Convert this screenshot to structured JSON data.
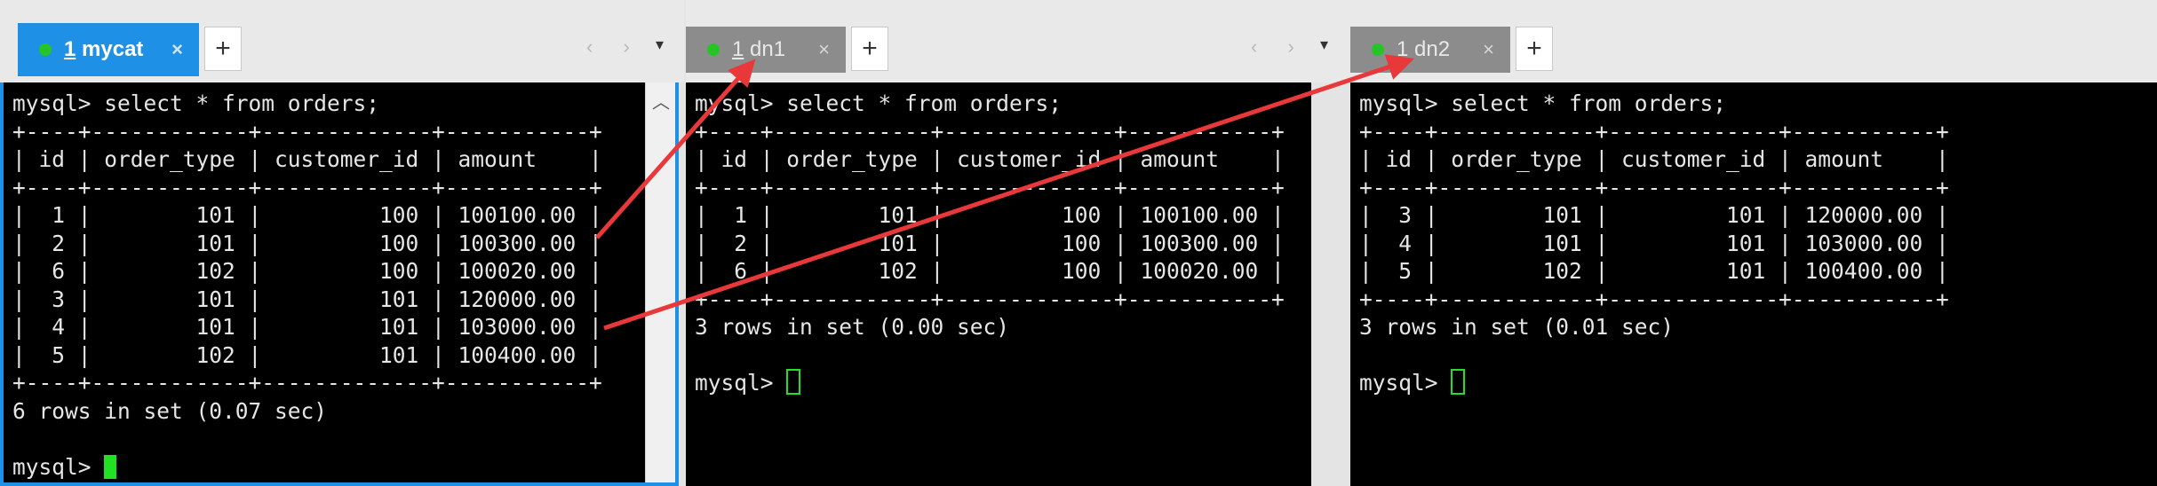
{
  "panes": [
    {
      "tab": {
        "number": "1",
        "name": "mycat",
        "close": "×"
      },
      "plus": "+",
      "nav": "‹ ›",
      "dropdown": "▾",
      "lines": [
        "mysql> select * from orders;",
        "+----+------------+-------------+-----------+",
        "| id | order_type | customer_id | amount    |",
        "+----+------------+-------------+-----------+",
        "|  1 |        101 |         100 | 100100.00 |",
        "|  2 |        101 |         100 | 100300.00 |",
        "|  6 |        102 |         100 | 100020.00 |",
        "|  3 |        101 |         101 | 120000.00 |",
        "|  4 |        101 |         101 | 103000.00 |",
        "|  5 |        102 |         101 | 100400.00 |",
        "+----+------------+-------------+-----------+",
        "6 rows in set (0.07 sec)",
        ""
      ],
      "prompt": "mysql> "
    },
    {
      "tab": {
        "number": "1",
        "name": "dn1",
        "close": "×"
      },
      "plus": "+",
      "nav": "‹ ›",
      "dropdown": "▾",
      "lines": [
        "mysql> select * from orders;",
        "+----+------------+-------------+-----------+",
        "| id | order_type | customer_id | amount    |",
        "+----+------------+-------------+-----------+",
        "|  1 |        101 |         100 | 100100.00 |",
        "|  2 |        101 |         100 | 100300.00 |",
        "|  6 |        102 |         100 | 100020.00 |",
        "+----+------------+-------------+-----------+",
        "3 rows in set (0.00 sec)",
        ""
      ],
      "prompt": "mysql> "
    },
    {
      "tab": {
        "number": "1",
        "name": "dn2",
        "close": "×"
      },
      "plus": "+",
      "lines": [
        "mysql> select * from orders;",
        "+----+------------+-------------+-----------+",
        "| id | order_type | customer_id | amount    |",
        "+----+------------+-------------+-----------+",
        "|  3 |        101 |         101 | 120000.00 |",
        "|  4 |        101 |         101 | 103000.00 |",
        "|  5 |        102 |         101 | 100400.00 |",
        "+----+------------+-------------+-----------+",
        "3 rows in set (0.01 sec)",
        ""
      ],
      "prompt": "mysql> "
    }
  ],
  "colors": {
    "accent": "#1e90e6",
    "arrow": "#e8383a",
    "cursor": "#22e022",
    "status_dot": "#27c427"
  },
  "icons": [
    "status-dot-icon",
    "close-icon",
    "plus-icon",
    "scroll-up-icon",
    "arrow-annotation"
  ]
}
